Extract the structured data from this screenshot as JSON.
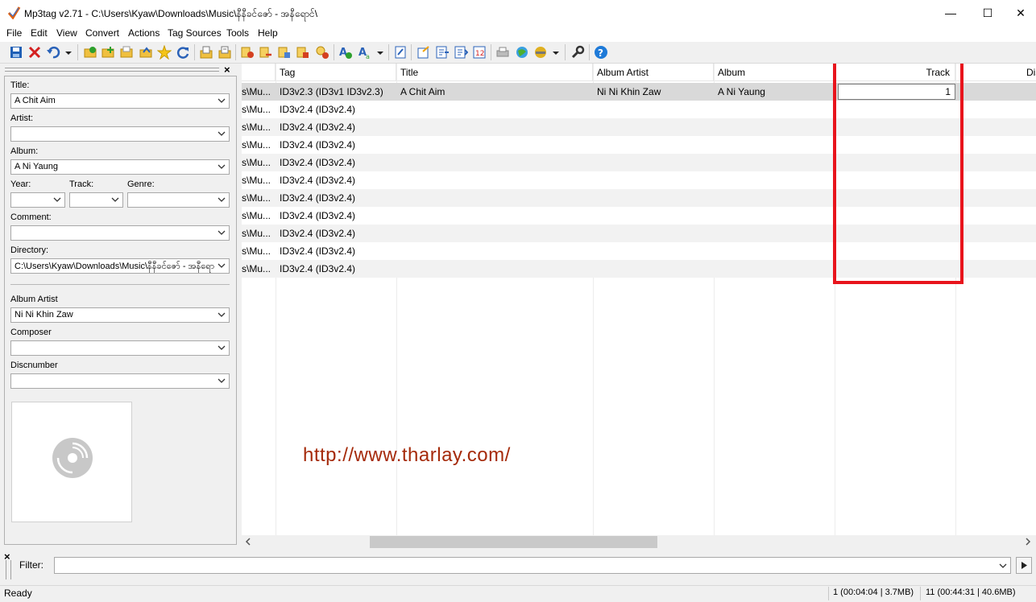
{
  "window": {
    "title": "Mp3tag v2.71  -  C:\\Users\\Kyaw\\Downloads\\Music\\နီနီခင်ဇော် - အနီရောင်\\",
    "minimize": "—",
    "maximize": "☐",
    "close": "✕"
  },
  "menu": [
    "File",
    "Edit",
    "View",
    "Convert",
    "Actions",
    "Tag Sources",
    "Tools",
    "Help"
  ],
  "toolbar": {
    "icons": [
      "save-icon",
      "remove-tag-icon",
      "undo-icon",
      "undo-dropdown-icon",
      "change-directory-icon",
      "add-directory-icon",
      "open-folder-icon",
      "export-folder-icon",
      "favorite-star-icon",
      "refresh-icon",
      "export-icon",
      "playlist-icon",
      "tag-to-filename-icon",
      "filename-to-tag-icon",
      "tag-to-tag-icon",
      "text-file-to-tag-icon",
      "filename-to-filename-icon",
      "actions-icon",
      "quick-actions-icon",
      "actions-dropdown-icon",
      "extended-tags-icon",
      "autonumber-wizard-icon",
      "import-cover-icon",
      "export-cover-icon",
      "numbering-icon",
      "print-icon",
      "web-source-icon",
      "tag-sources-icon",
      "tag-sources-dropdown-icon",
      "options-wrench-icon",
      "help-icon"
    ]
  },
  "left_panel": {
    "title_label": "Title:",
    "title_value": "A Chit Aim",
    "artist_label": "Artist:",
    "artist_value": "",
    "album_label": "Album:",
    "album_value": "A Ni Yaung",
    "year_label": "Year:",
    "track_label": "Track:",
    "genre_label": "Genre:",
    "comment_label": "Comment:",
    "directory_label": "Directory:",
    "directory_value": "C:\\Users\\Kyaw\\Downloads\\Music\\နီနီခင်ဇော် - အနီရောင်",
    "album_artist_label": "Album Artist",
    "album_artist_value": "Ni Ni Khin Zaw",
    "composer_label": "Composer",
    "discnumber_label": "Discnumber",
    "close_glyph": "×"
  },
  "grid": {
    "columns": [
      "Tag",
      "Title",
      "Album Artist",
      "Album",
      "Track",
      "Dis"
    ],
    "sort_indicator": "^",
    "rows": [
      {
        "path": "s\\Mu...",
        "tag": "ID3v2.3 (ID3v1 ID3v2.3)",
        "title": "A Chit Aim",
        "album_artist": "Ni Ni Khin Zaw",
        "album": "A Ni Yaung",
        "track": "1"
      },
      {
        "path": "s\\Mu...",
        "tag": "ID3v2.4 (ID3v2.4)",
        "title": "",
        "album_artist": "",
        "album": "",
        "track": ""
      },
      {
        "path": "s\\Mu...",
        "tag": "ID3v2.4 (ID3v2.4)",
        "title": "",
        "album_artist": "",
        "album": "",
        "track": ""
      },
      {
        "path": "s\\Mu...",
        "tag": "ID3v2.4 (ID3v2.4)",
        "title": "",
        "album_artist": "",
        "album": "",
        "track": ""
      },
      {
        "path": "s\\Mu...",
        "tag": "ID3v2.4 (ID3v2.4)",
        "title": "",
        "album_artist": "",
        "album": "",
        "track": ""
      },
      {
        "path": "s\\Mu...",
        "tag": "ID3v2.4 (ID3v2.4)",
        "title": "",
        "album_artist": "",
        "album": "",
        "track": ""
      },
      {
        "path": "s\\Mu...",
        "tag": "ID3v2.4 (ID3v2.4)",
        "title": "",
        "album_artist": "",
        "album": "",
        "track": ""
      },
      {
        "path": "s\\Mu...",
        "tag": "ID3v2.4 (ID3v2.4)",
        "title": "",
        "album_artist": "",
        "album": "",
        "track": ""
      },
      {
        "path": "s\\Mu...",
        "tag": "ID3v2.4 (ID3v2.4)",
        "title": "",
        "album_artist": "",
        "album": "",
        "track": ""
      },
      {
        "path": "s\\Mu...",
        "tag": "ID3v2.4 (ID3v2.4)",
        "title": "",
        "album_artist": "",
        "album": "",
        "track": ""
      },
      {
        "path": "s\\Mu...",
        "tag": "ID3v2.4 (ID3v2.4)",
        "title": "",
        "album_artist": "",
        "album": "",
        "track": ""
      }
    ],
    "watermark": "http://www.tharlay.com/",
    "highlight_color": "#e8141c"
  },
  "filter": {
    "label": "Filter:",
    "value": "",
    "close_glyph": "×"
  },
  "status": {
    "left": "Ready",
    "selected": "1 (00:04:04 | 3.7MB)",
    "total": "11 (00:44:31 | 40.6MB)"
  },
  "colors": {
    "selected_row": "#d9d9d9",
    "alt_row": "#f2f2f2",
    "watermark": "#a52a0a"
  }
}
